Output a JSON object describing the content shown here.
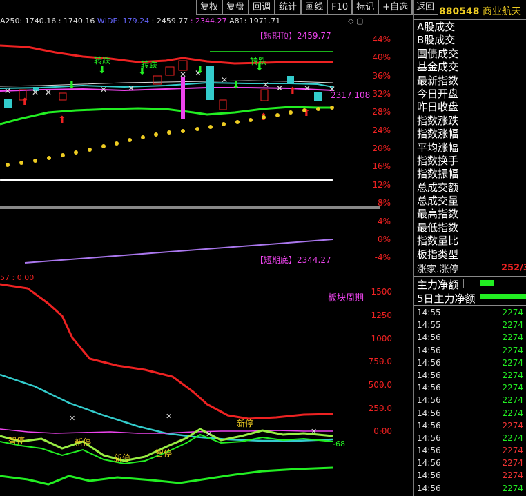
{
  "toolbar": {
    "items": [
      "复权",
      "复盘",
      "回调",
      "统计",
      "画线",
      "F10",
      "标记",
      "+自选",
      "返回"
    ]
  },
  "indicator_line": {
    "a250": "A250: 1740.16",
    "val2": ": 1740.16",
    "wide": "WIDE: 179.24",
    "val3": ": 2459.77",
    "val4": ": 2344.27",
    "a81": "A81: 1971.71"
  },
  "upper_axis": [
    "44%",
    "40%",
    "36%",
    "32%",
    "28%",
    "24%",
    "20%",
    "16%",
    "12%",
    "8%",
    "4%",
    "0%",
    "-4%"
  ],
  "lower_axis": [
    "1500",
    "1250",
    "1000",
    "750.0",
    "500.0",
    "250.0",
    "0.00"
  ],
  "annotations": {
    "top_label": "【短期顶】2459.77",
    "bottom_label": "【短期底】2344.27",
    "current_value": "2317.108",
    "panel2_label": "板块周期",
    "panel2_header": "57 : 0.00",
    "chart_words_green": [
      "转跌",
      "转跌",
      "转跌"
    ],
    "chart_words_yellow": [
      "新停",
      "新停",
      "新停",
      "智停",
      "智停"
    ]
  },
  "stock": {
    "code": "880548",
    "name": "商业航天"
  },
  "menu_items": [
    "A股成交",
    "B股成交",
    "国债成交",
    "基金成交",
    "最新指数",
    "今日开盘",
    "昨日收盘",
    "指数涨跌",
    "指数涨幅",
    "平均涨幅",
    "指数换手",
    "指数振幅",
    "总成交额",
    "总成交量",
    "最高指数",
    "最低指数",
    "指数量比",
    "板指类型"
  ],
  "stats": {
    "up_label": "涨家.涨停",
    "up_value": "252/3",
    "main_net": "主力净额",
    "main_net5": "5日主力净额"
  },
  "trades": [
    {
      "time": "14:55",
      "value": "2274",
      "color": "green"
    },
    {
      "time": "14:55",
      "value": "2274",
      "color": "green"
    },
    {
      "time": "14:56",
      "value": "2274",
      "color": "green"
    },
    {
      "time": "14:56",
      "value": "2274",
      "color": "green"
    },
    {
      "time": "14:56",
      "value": "2274",
      "color": "green"
    },
    {
      "time": "14:56",
      "value": "2274",
      "color": "green"
    },
    {
      "time": "14:56",
      "value": "2274",
      "color": "green"
    },
    {
      "time": "14:56",
      "value": "2274",
      "color": "green"
    },
    {
      "time": "14:56",
      "value": "2274",
      "color": "green"
    },
    {
      "time": "14:56",
      "value": "2274",
      "color": "red"
    },
    {
      "time": "14:56",
      "value": "2274",
      "color": "green"
    },
    {
      "time": "14:56",
      "value": "2274",
      "color": "red"
    },
    {
      "time": "14:56",
      "value": "2274",
      "color": "red"
    },
    {
      "time": "14:56",
      "value": "2274",
      "color": "red"
    },
    {
      "time": "14:56",
      "value": "2274",
      "color": "green"
    },
    {
      "time": "14:56",
      "value": "2274",
      "color": "red"
    }
  ],
  "colors": {
    "red": "#e22",
    "green": "#2e2",
    "cyan": "#3cc",
    "magenta": "#e4e",
    "yellow": "#ec2",
    "purple": "#a7e"
  }
}
